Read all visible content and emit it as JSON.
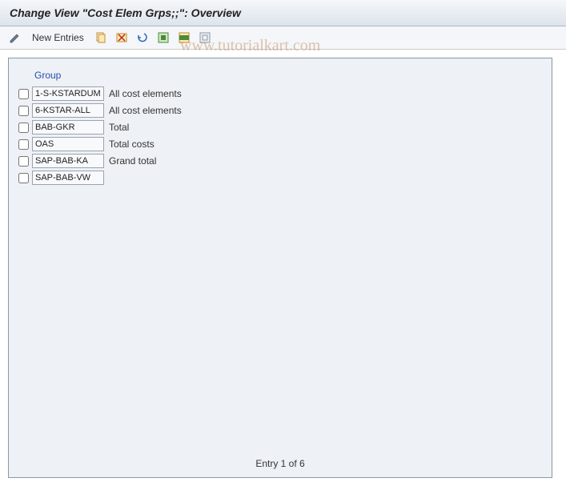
{
  "title": "Change View \"Cost Elem Grps;;\": Overview",
  "toolbar": {
    "new_entries_label": "New Entries"
  },
  "watermark": "www.tutorialkart.com",
  "group_header": "Group",
  "rows": [
    {
      "code": "1-S-KSTARDUM",
      "desc": "All cost elements"
    },
    {
      "code": "6-KSTAR-ALL",
      "desc": "All cost elements"
    },
    {
      "code": "BAB-GKR",
      "desc": "Total"
    },
    {
      "code": "OAS",
      "desc": "Total costs"
    },
    {
      "code": "SAP-BAB-KA",
      "desc": "Grand total"
    },
    {
      "code": "SAP-BAB-VW",
      "desc": ""
    }
  ],
  "footer": "Entry 1 of 6"
}
